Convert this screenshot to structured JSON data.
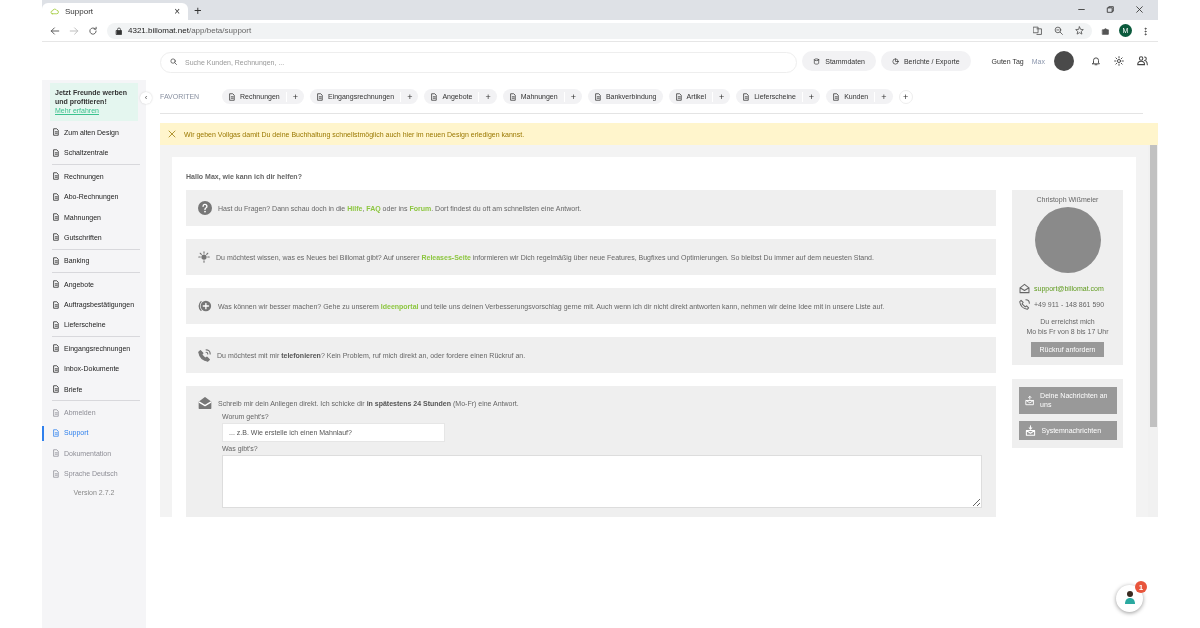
{
  "browser": {
    "tab_title": "Support",
    "tab_close": "×",
    "new_tab": "+",
    "url_host": "4321.billomat.net",
    "url_path": "/app/beta/support",
    "profile_initial": "M"
  },
  "header": {
    "search": {
      "placeholder": "Suche Kunden, Rechnungen, ..."
    },
    "buttons": [
      "Stammdaten",
      "Berichte / Exporte"
    ],
    "greeting": "Guten Tag",
    "user_name": "Max"
  },
  "sidebar": {
    "promo_text": "Jetzt Freunde werben und profitieren!",
    "promo_link": "Mehr erfahren",
    "groups": [
      [
        {
          "label": "Zum alten Design",
          "selected": false,
          "disabled": false
        },
        {
          "label": "Schaltzentrale",
          "selected": false,
          "disabled": false
        }
      ],
      [
        {
          "label": "Rechnungen",
          "selected": false,
          "disabled": false
        },
        {
          "label": "Abo-Rechnungen",
          "selected": false,
          "disabled": false
        },
        {
          "label": "Mahnungen",
          "selected": false,
          "disabled": false
        },
        {
          "label": "Gutschriften",
          "selected": false,
          "disabled": false
        }
      ],
      [
        {
          "label": "Banking",
          "selected": false,
          "disabled": false
        }
      ],
      [
        {
          "label": "Angebote",
          "selected": false,
          "disabled": false
        },
        {
          "label": "Auftragsbestätigungen",
          "selected": false,
          "disabled": false
        },
        {
          "label": "Lieferscheine",
          "selected": false,
          "disabled": false
        }
      ],
      [
        {
          "label": "Eingangsrechnungen",
          "selected": false,
          "disabled": false
        },
        {
          "label": "Inbox-Dokumente",
          "selected": false,
          "disabled": false
        },
        {
          "label": "Briefe",
          "selected": false,
          "disabled": false
        }
      ],
      [
        {
          "label": "Abmelden",
          "selected": false,
          "disabled": true
        },
        {
          "label": "Support",
          "selected": true,
          "disabled": false
        },
        {
          "label": "Dokumentation",
          "selected": false,
          "disabled": true
        },
        {
          "label": "Sprache Deutsch",
          "selected": false,
          "disabled": true
        }
      ]
    ],
    "version": "Version 2.7.2",
    "collapse": "‹"
  },
  "favorites": {
    "label": "FAVORITEN",
    "items": [
      {
        "label": "Rechnungen",
        "add": "+"
      },
      {
        "label": "Eingangsrechnungen",
        "add": "+"
      },
      {
        "label": "Angebote",
        "add": "+"
      },
      {
        "label": "Mahnungen",
        "add": "+"
      },
      {
        "label": "Bankverbindung"
      },
      {
        "label": "Artikel",
        "add": "+"
      },
      {
        "label": "Lieferscheine",
        "add": "+"
      },
      {
        "label": "Kunden",
        "add": "+"
      }
    ],
    "add_new": "+"
  },
  "banner": "Wir geben Vollgas damit Du deine Buchhaltung schnellstmöglich auch hier im neuen Design erledigen kannst.",
  "support": {
    "greeting": "Hallo Max, wie kann ich dir helfen?",
    "sections": [
      {
        "kind": "question",
        "parts": [
          {
            "kind": "text",
            "text": "Hast du Fragen? Dann schau doch in die "
          },
          {
            "kind": "link",
            "text": "Hilfe"
          },
          {
            "kind": "text",
            "text": ", "
          },
          {
            "kind": "link",
            "text": "FAQ"
          },
          {
            "kind": "text",
            "text": " oder ins "
          },
          {
            "kind": "link",
            "text": "Forum"
          },
          {
            "kind": "text",
            "text": ". Dort findest du oft am schnellsten eine Antwort."
          }
        ]
      },
      {
        "kind": "bulb",
        "parts": [
          {
            "kind": "text",
            "text": "Du möchtest wissen, was es Neues bei Billomat gibt? Auf unserer "
          },
          {
            "kind": "link",
            "text": "Releases-Seite"
          },
          {
            "kind": "text",
            "text": " informieren wir Dich regelmäßig über neue Features, Bugfixes und Optimierungen. So bleibst Du immer auf dem neuesten Stand."
          }
        ]
      },
      {
        "kind": "idea",
        "parts": [
          {
            "kind": "text",
            "text": "Was können wir besser machen? Gehe zu unserem "
          },
          {
            "kind": "link",
            "text": "Ideenportal"
          },
          {
            "kind": "text",
            "text": " und teile uns deinen Verbesserungsvorschlag gerne mit. Auch wenn ich dir nicht direkt antworten kann, nehmen wir deine Idee mit in unsere Liste auf."
          }
        ]
      },
      {
        "kind": "phone",
        "parts": [
          {
            "kind": "text",
            "text": "Du möchtest mit mir **telefonieren**? Kein Problem, ruf mich direkt an, oder fordere einen Rückruf an."
          }
        ]
      },
      {
        "kind": "mail",
        "parts": [
          {
            "kind": "text",
            "text": "Schreib mir dein Anliegen direkt. Ich schicke dir **in spätestens 24 Stunden** (Mo-Fr) eine Antwort."
          }
        ],
        "form": {
          "subject_label": "Worum geht's?",
          "subject_placeholder": "... z.B. Wie erstelle ich einen Mahnlauf?",
          "message_label": "Was gibt's?"
        }
      }
    ],
    "contact": {
      "name": "Christoph Wißmeier",
      "email": "support@billomat.com",
      "phone": "+49 911 - 148 861 590",
      "hours": [
        "Du erreichst mich",
        "Mo bis Fr von 8 bis 17 Uhr"
      ],
      "callback_button": "Rückruf anfordern"
    },
    "message_buttons": [
      "Deine Nachrichten an uns",
      "Systemnachrichten"
    ]
  },
  "chat": {
    "badge": "1"
  }
}
